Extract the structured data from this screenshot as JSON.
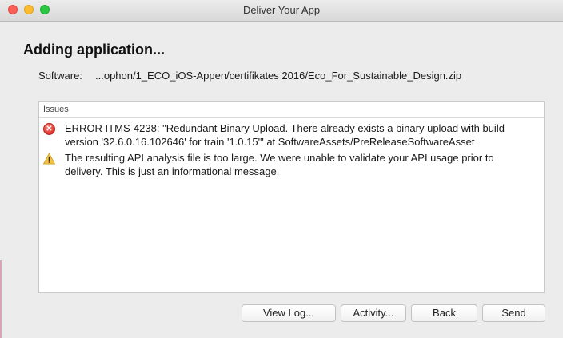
{
  "window": {
    "title": "Deliver Your App"
  },
  "heading": "Adding application...",
  "software": {
    "label": "Software:",
    "value": "...ophon/1_ECO_iOS-Appen/certifikates 2016/Eco_For_Sustainable_Design.zip"
  },
  "issues": {
    "header": "Issues",
    "items": [
      {
        "type": "error",
        "icon": "error-icon",
        "line1": "ERROR ITMS-4238: \"Redundant Binary Upload. There already exists a binary upload with build",
        "line2": "version '32.6.0.16.102646' for train '1.0.15'\" at SoftwareAssets/PreReleaseSoftwareAsset"
      },
      {
        "type": "warning",
        "icon": "warning-icon",
        "line1": "The resulting API analysis file is too large.  We were unable to validate your API usage prior to",
        "line2": "delivery.  This is just an informational message."
      }
    ]
  },
  "buttons": {
    "view_log": "View Log...",
    "activity": "Activity...",
    "back": "Back",
    "send": "Send"
  },
  "colors": {
    "error": "#d8322b",
    "warning": "#f5c342"
  }
}
